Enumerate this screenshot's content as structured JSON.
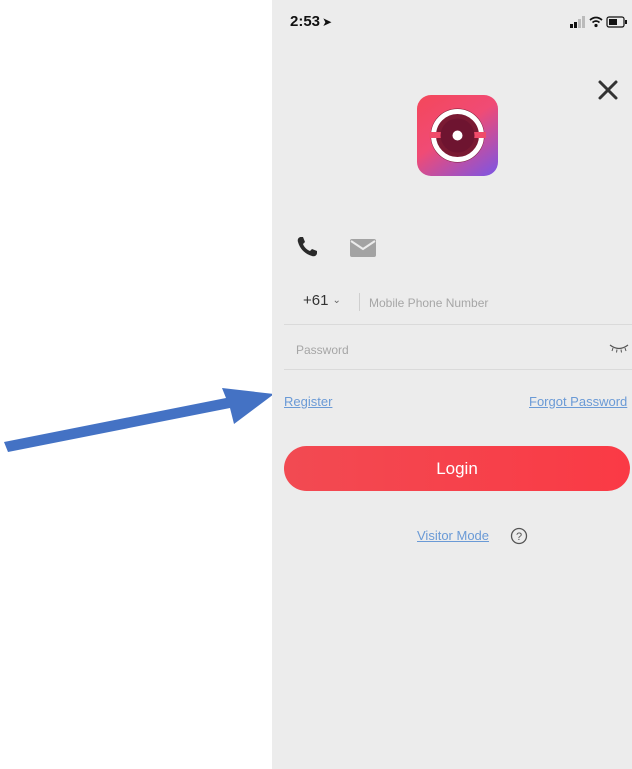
{
  "status_bar": {
    "time": "2:53",
    "location_icon": "location-arrow-icon",
    "signal_icon": "signal-icon",
    "wifi_icon": "wifi-icon",
    "battery_icon": "battery-icon"
  },
  "header": {
    "close_icon": "close-icon"
  },
  "logo": {
    "icon": "app-logo-icon",
    "colors": [
      "#f4475a",
      "#f04b75",
      "#7a55e6"
    ]
  },
  "login_methods": {
    "phone_icon": "phone-icon",
    "email_icon": "mail-icon",
    "active": "phone"
  },
  "form": {
    "country_code": "+61",
    "country_code_chevron": "⌄",
    "phone_placeholder": "Mobile Phone Number",
    "phone_value": "",
    "password_placeholder": "Password",
    "password_value": "",
    "password_toggle_icon": "eye-closed-icon"
  },
  "links": {
    "register": "Register",
    "forgot_password": "Forgot Password"
  },
  "login_button": {
    "label": "Login",
    "color": "#f73f4a"
  },
  "footer": {
    "visitor_mode": "Visitor Mode",
    "help_icon": "help-circle-icon"
  },
  "annotation": {
    "arrow_icon": "pointer-arrow-icon",
    "color": "#4472c4"
  },
  "colors": {
    "background": "#ececec",
    "link": "#6a9ad6"
  }
}
